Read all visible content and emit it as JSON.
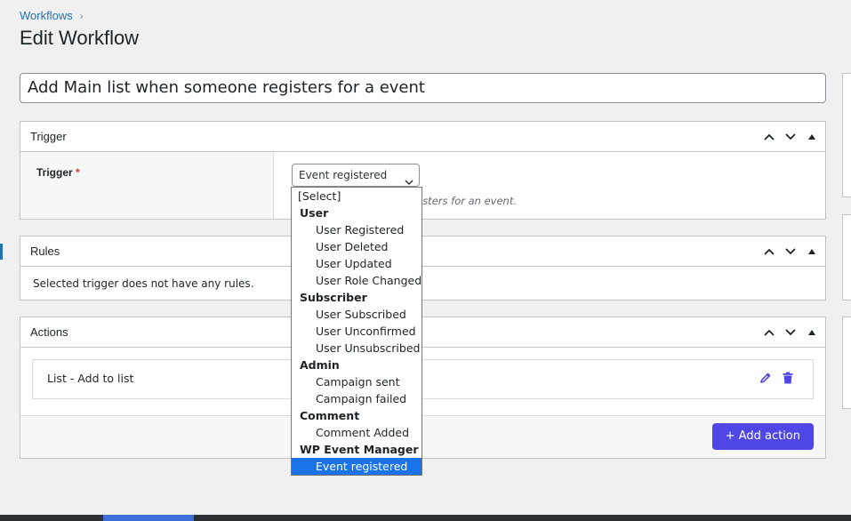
{
  "breadcrumb": {
    "link": "Workflows",
    "separator": "›"
  },
  "page_title": "Edit Workflow",
  "workflow_name": "Add Main list when someone registers for a event",
  "trigger_box": {
    "header": "Trigger",
    "label": "Trigger",
    "required_mark": "*",
    "selected_value": "Event registered",
    "description": "isters for an event."
  },
  "dropdown": {
    "options": [
      {
        "type": "option",
        "label": "[Select]"
      },
      {
        "type": "group",
        "label": "User"
      },
      {
        "type": "sub",
        "label": "User Registered"
      },
      {
        "type": "sub",
        "label": "User Deleted"
      },
      {
        "type": "sub",
        "label": "User Updated"
      },
      {
        "type": "sub",
        "label": "User Role Changed"
      },
      {
        "type": "group",
        "label": "Subscriber"
      },
      {
        "type": "sub",
        "label": "User Subscribed"
      },
      {
        "type": "sub",
        "label": "User Unconfirmed"
      },
      {
        "type": "sub",
        "label": "User Unsubscribed"
      },
      {
        "type": "group",
        "label": "Admin"
      },
      {
        "type": "sub",
        "label": "Campaign sent"
      },
      {
        "type": "sub",
        "label": "Campaign failed"
      },
      {
        "type": "group",
        "label": "Comment"
      },
      {
        "type": "sub",
        "label": "Comment Added"
      },
      {
        "type": "group",
        "label": "WP Event Manager"
      },
      {
        "type": "sub",
        "label": "Event registered",
        "selected": true
      }
    ]
  },
  "rules_box": {
    "header": "Rules",
    "message": "Selected trigger does not have any rules."
  },
  "actions_box": {
    "header": "Actions",
    "items": [
      {
        "label": "List - Add to list"
      }
    ],
    "add_button": "+ Add action"
  },
  "colors": {
    "accent": "#4f46e5",
    "link": "#2271b1",
    "selected_option": "#1a73e8",
    "required": "#d63638"
  }
}
